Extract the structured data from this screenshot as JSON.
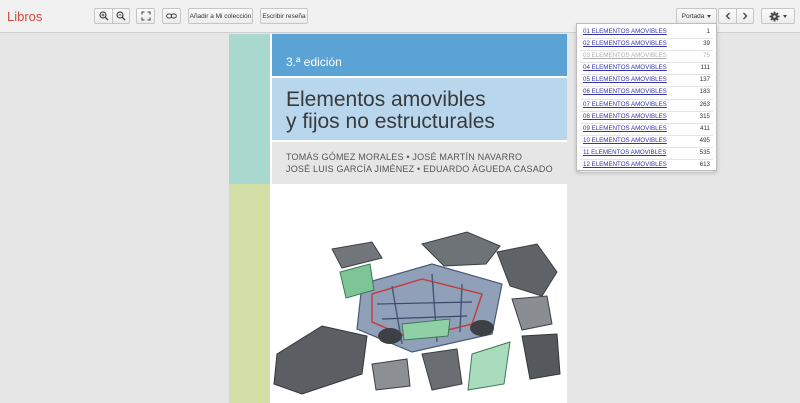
{
  "app": {
    "logo": "Libros"
  },
  "toolbar": {
    "add_collection": "Añadir a Mi colección",
    "write_review": "Escribir reseña",
    "section_select": "Portada"
  },
  "cover": {
    "edition": "3.ª edición",
    "title_line1": "Elementos amovibles",
    "title_line2": "y fijos no estructurales",
    "authors_line1": "TOMÁS GÓMEZ MORALES • JOSÉ MARTÍN NAVARRO",
    "authors_line2": "JOSÉ LUIS GARCÍA JIMÉNEZ • EDUARDO ÁGUEDA CASADO"
  },
  "toc": [
    {
      "label": "01 ELEMENTOS AMOVIBLES",
      "page": "1",
      "disabled": false
    },
    {
      "label": "02 ELEMENTOS AMOVIBLES",
      "page": "39",
      "disabled": false
    },
    {
      "label": "03 ELEMENTOS AMOVIBLES",
      "page": "75",
      "disabled": true
    },
    {
      "label": "04 ELEMENTOS AMOVIBLES",
      "page": "111",
      "disabled": false
    },
    {
      "label": "05 ELEMENTOS AMOVIBLES",
      "page": "137",
      "disabled": false
    },
    {
      "label": "06 ELEMENTOS AMOVIBLES",
      "page": "183",
      "disabled": false
    },
    {
      "label": "07 ELEMENTOS AMOVIBLES",
      "page": "263",
      "disabled": false
    },
    {
      "label": "08 ELEMENTOS AMOVIBLES",
      "page": "315",
      "disabled": false
    },
    {
      "label": "09 ELEMENTOS AMOVIBLES",
      "page": "411",
      "disabled": false
    },
    {
      "label": "10 ELEMENTOS AMOVIBLES",
      "page": "495",
      "disabled": false
    },
    {
      "label": "11 ELEMENTOS AMOVIBLES",
      "page": "535",
      "disabled": false
    },
    {
      "label": "12 ELEMENTOS AMOVIBLES",
      "page": "613",
      "disabled": false
    }
  ],
  "colors": {
    "logo": "#d1493c",
    "cover_blue": "#5ba3d5",
    "cover_light_blue": "#b8d6ec",
    "cover_teal": "#a9d8cf",
    "cover_green": "#d3dfa7",
    "link": "#3333aa"
  },
  "icons": [
    "zoom-in-icon",
    "zoom-out-icon",
    "fullscreen-icon",
    "link-icon",
    "chevron-left-icon",
    "chevron-right-icon",
    "gear-icon"
  ]
}
